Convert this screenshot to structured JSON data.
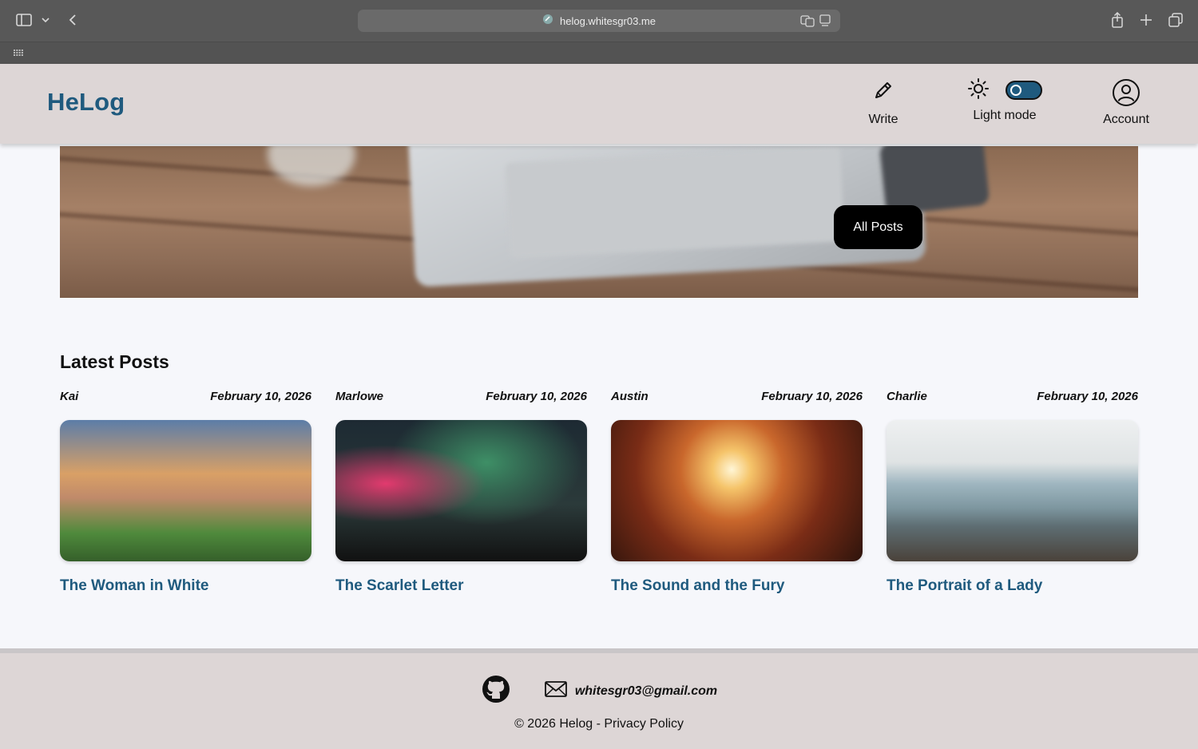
{
  "browser": {
    "url": "helog.whitesgr03.me"
  },
  "header": {
    "brand": "HeLog",
    "nav": {
      "write_label": "Write",
      "theme_label": "Light mode",
      "account_label": "Account"
    }
  },
  "hero": {
    "button_label": "All Posts"
  },
  "latest": {
    "title": "Latest Posts",
    "posts": [
      {
        "author": "Kai",
        "date": "February 10, 2026",
        "title": "The Woman in White"
      },
      {
        "author": "Marlowe",
        "date": "February 10, 2026",
        "title": "The Scarlet Letter"
      },
      {
        "author": "Austin",
        "date": "February 10, 2026",
        "title": "The Sound and the Fury"
      },
      {
        "author": "Charlie",
        "date": "February 10, 2026",
        "title": "The Portrait of a Lady"
      }
    ]
  },
  "footer": {
    "email": "whitesgr03@gmail.com",
    "copyright": "© 2026 Helog - Privacy Policy"
  },
  "colors": {
    "brand": "#1f5a7e",
    "header_bg": "#ddd6d6",
    "page_bg": "#f6f7fb"
  }
}
